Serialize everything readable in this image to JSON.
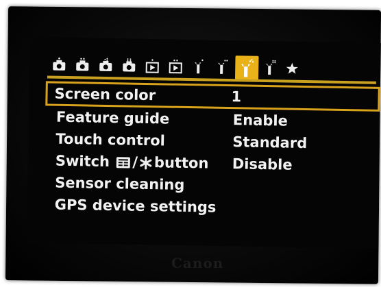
{
  "tabs": [
    {
      "icon": "camera-1-icon",
      "active": false
    },
    {
      "icon": "camera-2-icon",
      "active": false
    },
    {
      "icon": "camera-3-icon",
      "active": false
    },
    {
      "icon": "camera-4-icon",
      "active": false
    },
    {
      "icon": "playback-1-icon",
      "active": false
    },
    {
      "icon": "playback-2-icon",
      "active": false
    },
    {
      "icon": "wrench-1-icon",
      "active": false
    },
    {
      "icon": "wrench-2-icon",
      "active": false
    },
    {
      "icon": "wrench-3-icon",
      "active": true
    },
    {
      "icon": "wrench-4-icon",
      "active": false
    },
    {
      "icon": "star-icon",
      "active": false
    }
  ],
  "colors": {
    "accent": "#e8b218",
    "text": "#f2f2f2",
    "background": "#050505"
  },
  "menu": {
    "items": [
      {
        "label": "Screen color",
        "value": "1",
        "selected": true
      },
      {
        "label": "Feature guide",
        "value": "Enable"
      },
      {
        "label": "Touch control",
        "value": "Standard"
      },
      {
        "label_prefix": "Switch",
        "label_suffix": "button",
        "value": "Disable"
      },
      {
        "label": "Sensor cleaning",
        "value": ""
      },
      {
        "label": "GPS device settings",
        "value": ""
      }
    ]
  },
  "brand": "Canon"
}
